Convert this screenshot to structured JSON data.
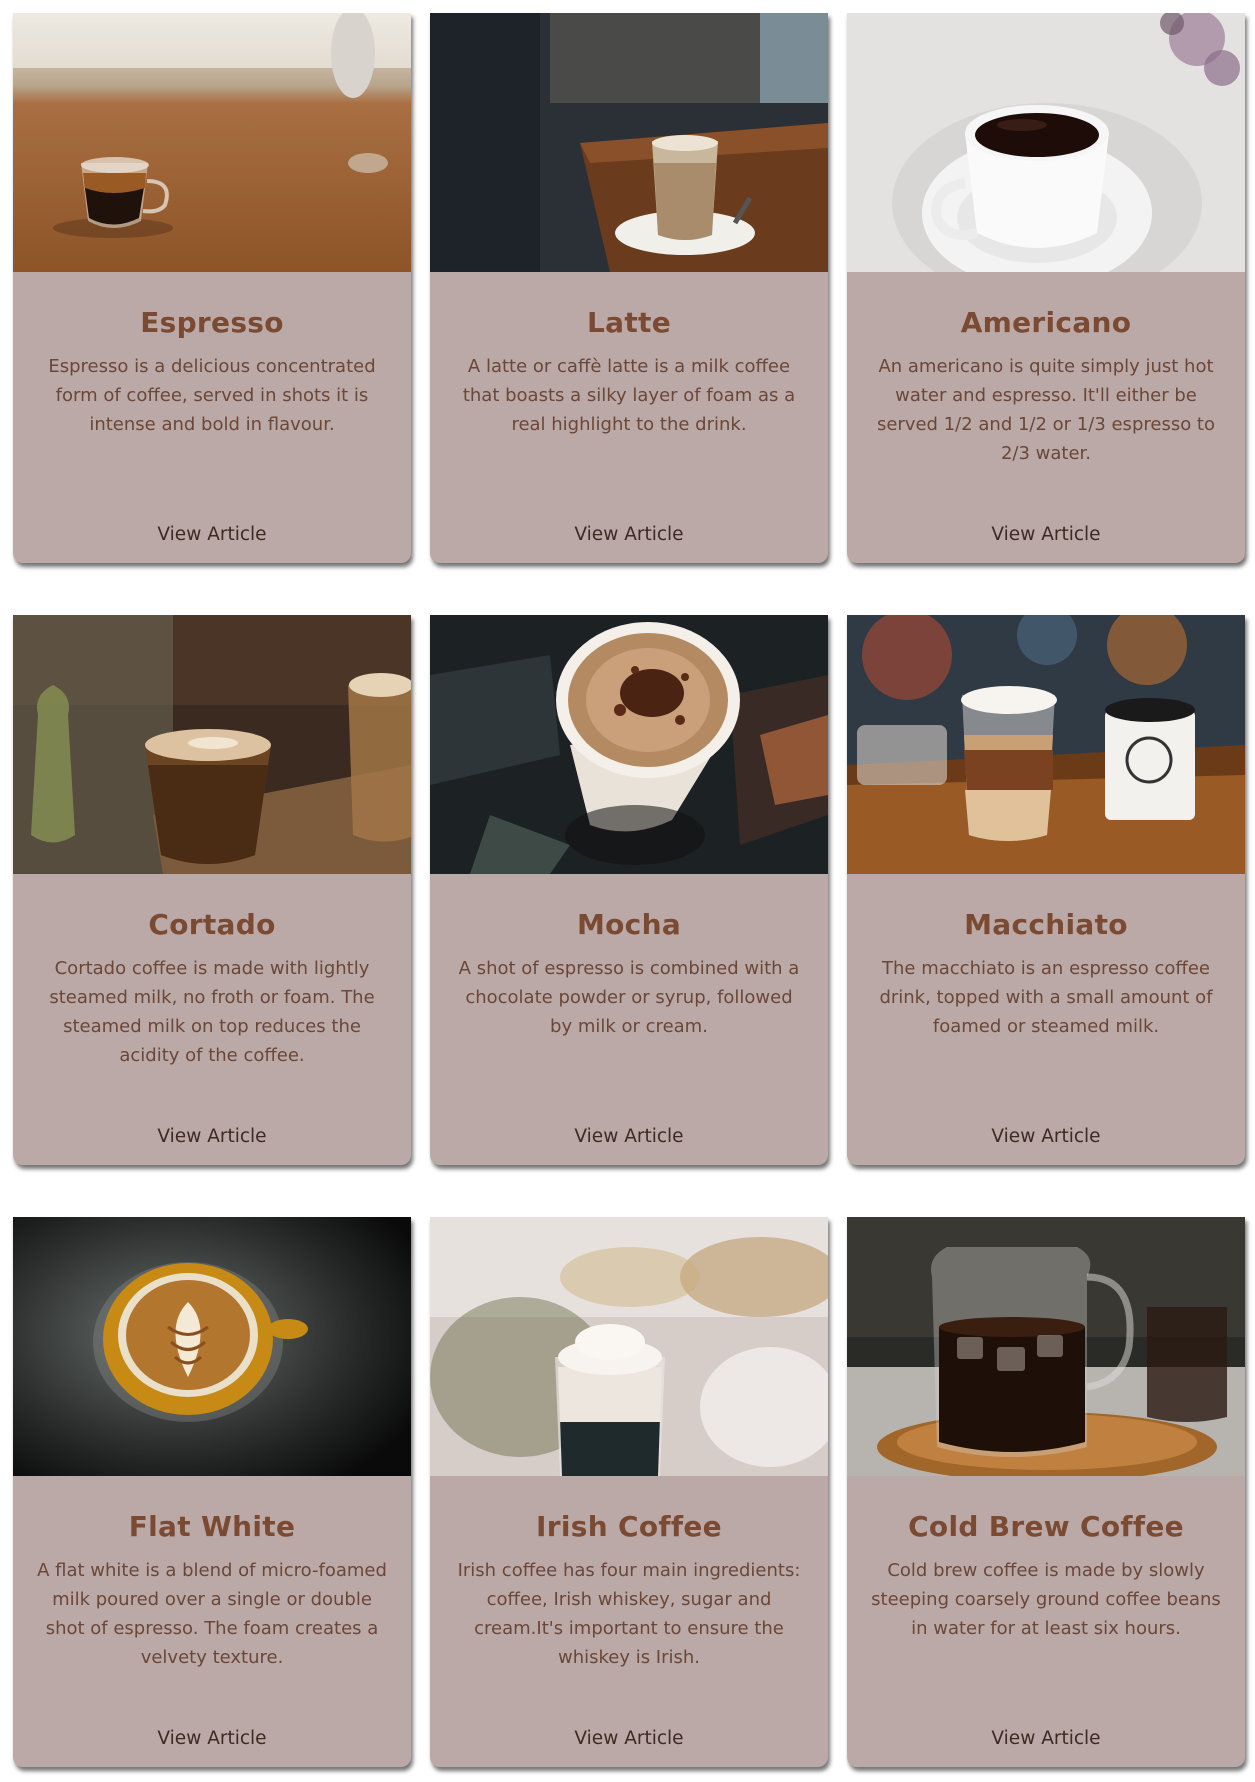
{
  "cards": [
    {
      "title": "Espresso",
      "description": "Espresso is a delicious concentrated form of coffee, served in shots it is intense and bold in flavour.",
      "link_label": "View Article",
      "image": "espresso-glass-cup-photo"
    },
    {
      "title": "Latte",
      "description": "A latte or caffè latte is a milk coffee that boasts a silky layer of foam as a real highlight to the drink.",
      "link_label": "View Article",
      "image": "latte-glass-photo"
    },
    {
      "title": "Americano",
      "description": "An americano is quite simply just hot water and espresso. It'll either be served 1/2 and 1/2 or 1/3 espresso to 2/3 water.",
      "link_label": "View Article",
      "image": "americano-white-cup-photo"
    },
    {
      "title": "Cortado",
      "description": "Cortado coffee is made with lightly steamed milk, no froth or foam. The steamed milk on top reduces the acidity of the coffee.",
      "link_label": "View Article",
      "image": "cortado-glass-photo"
    },
    {
      "title": "Mocha",
      "description": "A shot of espresso is combined with a chocolate powder or syrup, followed by milk or cream.",
      "link_label": "View Article",
      "image": "mocha-cup-photo"
    },
    {
      "title": "Macchiato",
      "description": "The macchiato is an espresso coffee drink, topped with a small amount of foamed or steamed milk.",
      "link_label": "View Article",
      "image": "macchiato-layered-glass-photo"
    },
    {
      "title": "Flat White",
      "description": "A flat white is a blend of micro-foamed milk poured over a single or double shot of espresso. The foam creates a velvety texture.",
      "link_label": "View Article",
      "image": "flat-white-latte-art-photo"
    },
    {
      "title": "Irish Coffee",
      "description": "Irish coffee has four main ingredients: coffee, Irish whiskey, sugar and cream.It's important to ensure the whiskey is Irish.",
      "link_label": "View Article",
      "image": "irish-coffee-glass-photo"
    },
    {
      "title": "Cold Brew Coffee",
      "description": "Cold brew coffee is made by slowly steeping coarsely ground coffee beans in water for at least six hours.",
      "link_label": "View Article",
      "image": "cold-brew-jug-photo"
    }
  ],
  "colors": {
    "card_background": "#bba9a7",
    "title": "#7a4a33",
    "text": "#6a4738",
    "link": "#3e2a22"
  }
}
